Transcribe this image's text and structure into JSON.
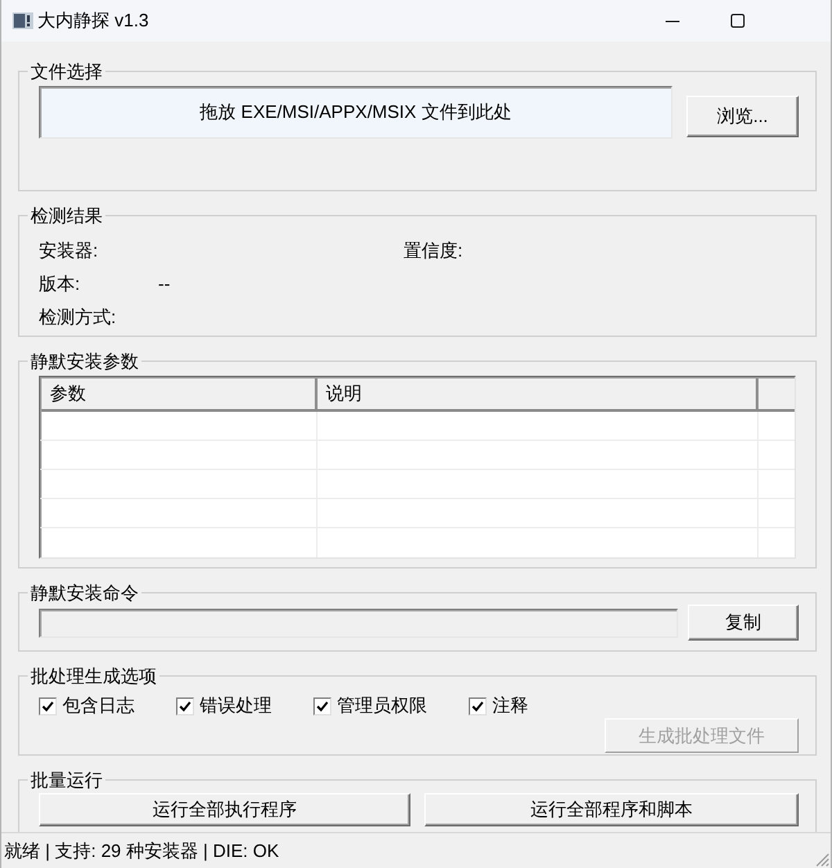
{
  "window": {
    "title": "大内静探 v1.3"
  },
  "file_selection": {
    "title": "文件选择",
    "drop_zone": "拖放 EXE/MSI/APPX/MSIX 文件到此处",
    "browse_button": "浏览..."
  },
  "detection_result": {
    "title": "检测结果",
    "rows": [
      [
        {
          "label": "安装器:"
        },
        {
          "label": "置信度:"
        }
      ],
      [
        {
          "label": "版本:",
          "value": "--"
        }
      ],
      [
        {
          "label": "检测方式:"
        }
      ]
    ]
  },
  "install_parameters": {
    "title": "静默安装参数",
    "table": {
      "columns": [
        "参数",
        "说明"
      ]
    }
  },
  "install_command": {
    "title": "静默安装命令",
    "copy_button": "复制"
  },
  "batch_options": {
    "title": "批处理生成选项",
    "options": [
      {
        "label": "包含日志",
        "checked": true
      },
      {
        "label": "错误处理",
        "checked": true
      },
      {
        "label": "管理员权限",
        "checked": true
      },
      {
        "label": "注释",
        "checked": true
      }
    ],
    "generate_button": {
      "label": "生成批处理文件",
      "disabled": true
    }
  },
  "batch_run": {
    "title": "批量运行",
    "buttons": [
      {
        "label": "运行全部执行程序"
      },
      {
        "label": "运行全部程序和脚本"
      }
    ]
  },
  "status_bar": {
    "text": "就绪 | 支持: 29 种安装器 | DIE: OK"
  }
}
